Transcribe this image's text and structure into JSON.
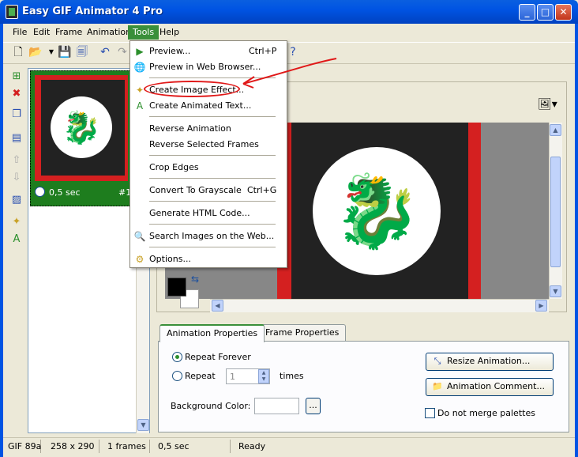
{
  "window": {
    "title": "Easy GIF Animator 4 Pro"
  },
  "menubar": {
    "items": [
      "File",
      "Edit",
      "Frame",
      "Animation",
      "Tools",
      "Help"
    ],
    "active": "Tools"
  },
  "tools_menu": {
    "items": [
      {
        "label": "Preview...",
        "shortcut": "Ctrl+P"
      },
      {
        "label": "Preview in Web Browser...",
        "shortcut": ""
      },
      {
        "label": "Create Image Effect...",
        "shortcut": ""
      },
      {
        "label": "Create Animated Text...",
        "shortcut": ""
      },
      {
        "label": "Reverse Animation",
        "shortcut": ""
      },
      {
        "label": "Reverse Selected Frames",
        "shortcut": ""
      },
      {
        "label": "Crop Edges",
        "shortcut": ""
      },
      {
        "label": "Convert To Grayscale",
        "shortcut": "Ctrl+G"
      },
      {
        "label": "Generate HTML Code...",
        "shortcut": ""
      },
      {
        "label": "Search Images on the Web...",
        "shortcut": ""
      },
      {
        "label": "Options...",
        "shortcut": ""
      }
    ]
  },
  "frame_thumb": {
    "delay": "0,5 sec",
    "number": "#1"
  },
  "properties": {
    "tabs": [
      "Animation Properties",
      "Frame Properties"
    ],
    "active_tab": "Animation Properties",
    "repeat_forever_label": "Repeat Forever",
    "repeat_label": "Repeat",
    "repeat_count": "1",
    "times_label": "times",
    "background_color_label": "Background Color:",
    "bg_browse": "...",
    "resize_button": "Resize Animation...",
    "comment_button": "Animation Comment...",
    "merge_label": "Do not merge palettes"
  },
  "statusbar": {
    "format": "GIF 89a",
    "size": "258 x 290",
    "frames": "1 frames",
    "duration": "0,5 sec",
    "status": "Ready"
  },
  "colors": {
    "accent": "#3a8f3a",
    "annotation": "#e01818",
    "titlebar": "#0054e3"
  }
}
